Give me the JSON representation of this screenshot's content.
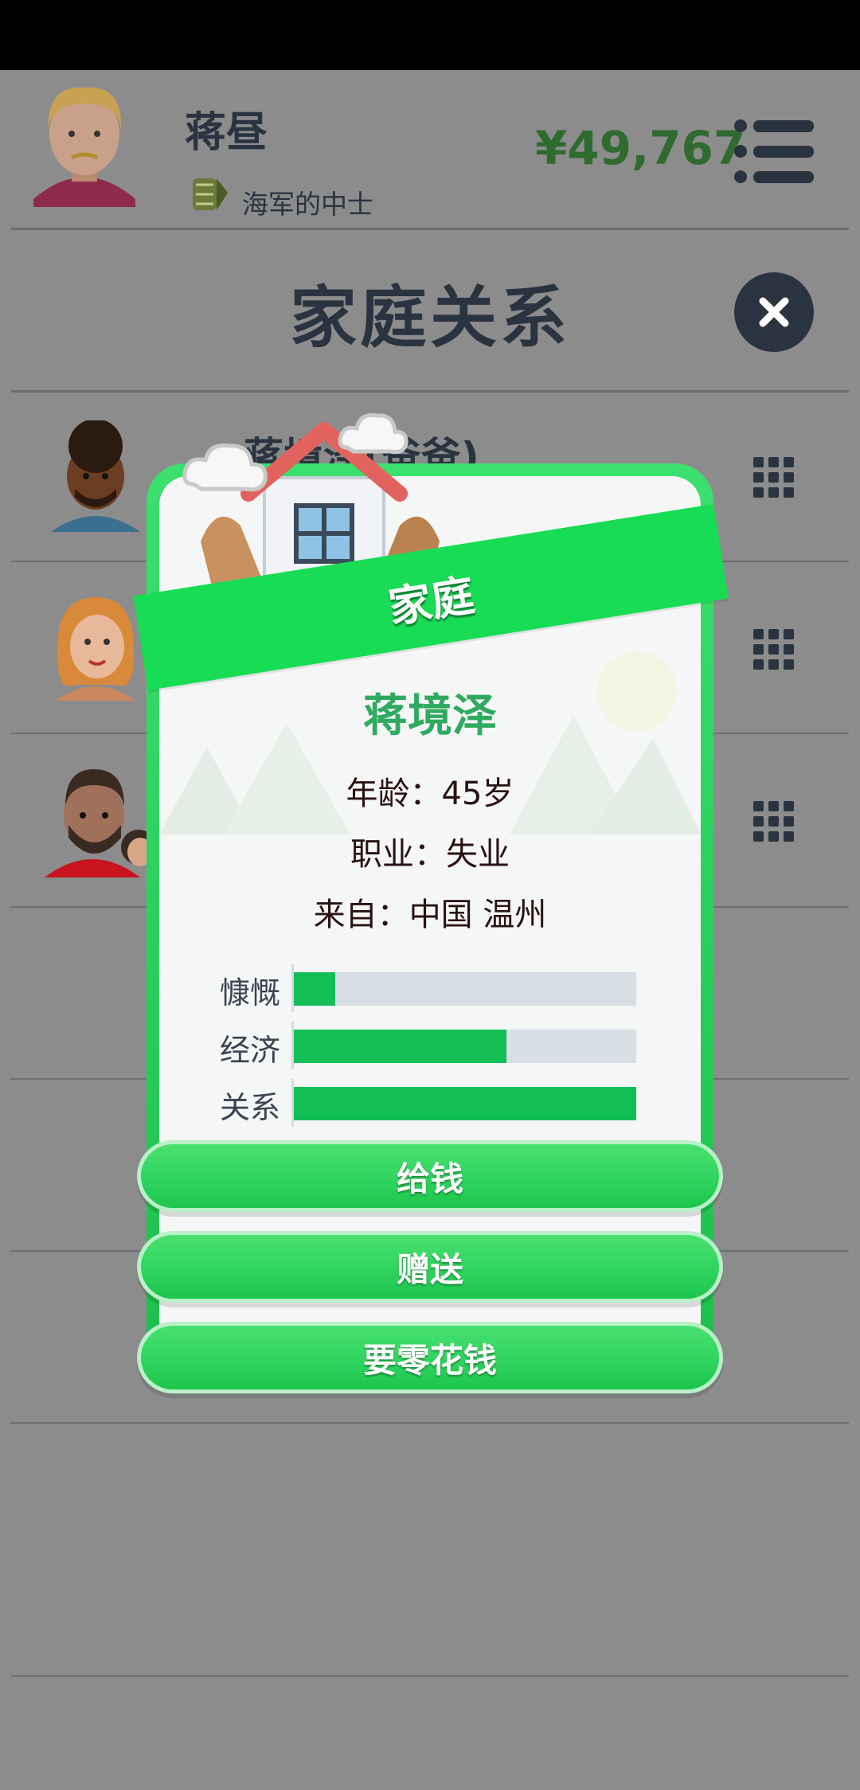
{
  "header": {
    "player_name": "蒋昼",
    "rank_text": "海军的中士",
    "money": "¥49,767"
  },
  "page": {
    "title": "家庭关系",
    "first_row_name": "蒋境泽(爸爸)"
  },
  "modal": {
    "banner": "家庭",
    "person_name": "蒋境泽",
    "age_line": "年龄：45岁",
    "job_line": "职业：失业",
    "from_line": "来自：中国 温州",
    "stats": [
      {
        "label": "慷慨",
        "value": 0.12
      },
      {
        "label": "经济",
        "value": 0.62
      },
      {
        "label": "关系",
        "value": 1.0
      }
    ],
    "buttons": [
      "给钱",
      "赠送",
      "要零花钱"
    ]
  },
  "colors": {
    "accent_green": "#19dc55",
    "money_green": "#2f6a2f",
    "stat_fill": "#13be57",
    "dark": "#2a3340"
  }
}
